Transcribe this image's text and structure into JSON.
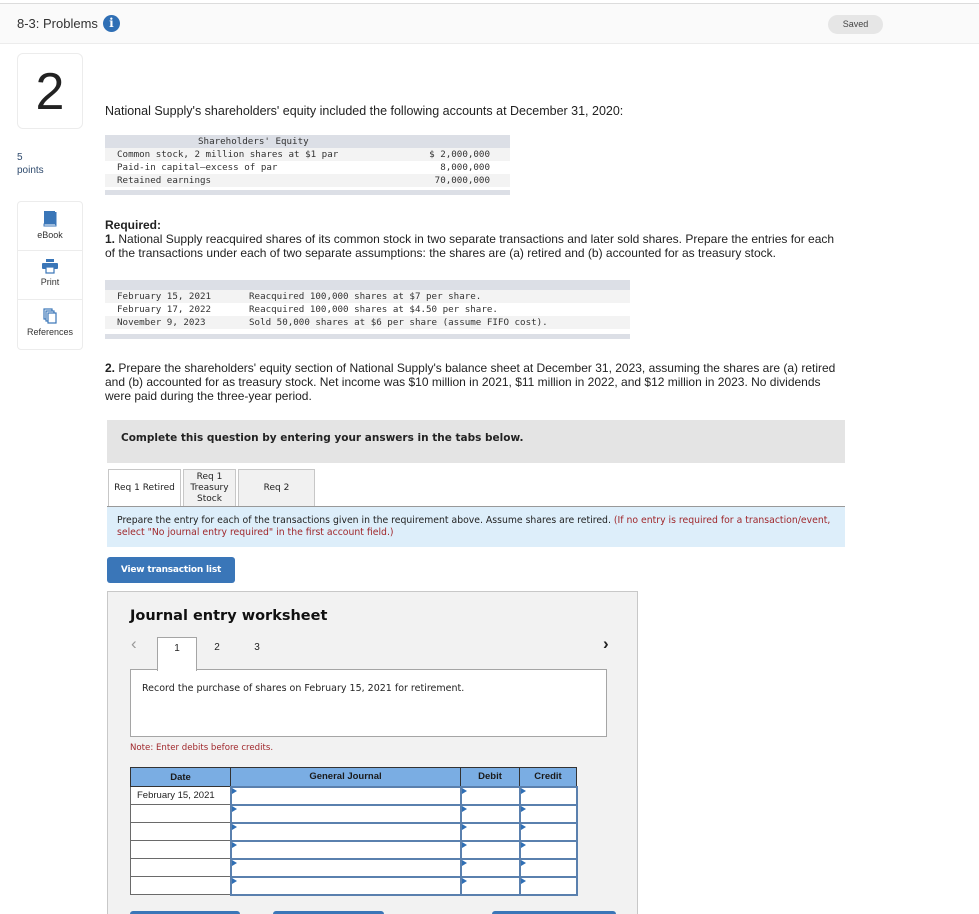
{
  "header": {
    "title": "8-3: Problems",
    "info_icon": "info-icon",
    "saved_label": "Saved"
  },
  "question": {
    "number": "2",
    "points_value": "5",
    "points_label": "points"
  },
  "tools": [
    {
      "label": "eBook",
      "icon": "book-icon"
    },
    {
      "label": "Print",
      "icon": "printer-icon"
    },
    {
      "label": "References",
      "icon": "copy-pages-icon"
    }
  ],
  "intro": "National Supply's shareholders' equity included the following accounts at December 31, 2020:",
  "equity_table": {
    "header": "Shareholders' Equity",
    "rows": [
      {
        "label": "Common stock, 2 million shares at $1 par",
        "value": "$ 2,000,000"
      },
      {
        "label": "Paid-in capital—excess of par",
        "value": "8,000,000"
      },
      {
        "label": "Retained earnings",
        "value": "70,000,000"
      }
    ]
  },
  "required": {
    "heading": "Required:",
    "req1_num": "1.",
    "req1_text": "National Supply reacquired shares of its common stock in two separate transactions and later sold shares. Prepare the entries for each of the transactions under each of two separate assumptions: the shares are (a) retired and (b) accounted for as treasury stock.",
    "req2_num": "2.",
    "req2_text": "Prepare the shareholders' equity section of National Supply's balance sheet at December 31, 2023, assuming the shares are (a) retired and (b) accounted for as treasury stock. Net income was $10 million in 2021, $11 million in 2022, and $12 million in 2023. No dividends were paid during the three-year period."
  },
  "transactions": [
    {
      "date": "February 15, 2021",
      "desc": "Reacquired 100,000 shares at $7 per share."
    },
    {
      "date": "February 17, 2022",
      "desc": "Reacquired 100,000 shares at $4.50 per share."
    },
    {
      "date": "November 9, 2023",
      "desc": "Sold 50,000 shares at $6 per share (assume FIFO cost)."
    }
  ],
  "instruction_bar": "Complete this question by entering your answers in the tabs below.",
  "tabs": [
    {
      "label": "Req 1 Retired",
      "active": true
    },
    {
      "label": "Req 1 Treasury Stock",
      "active": false
    },
    {
      "label": "Req 2",
      "active": false
    }
  ],
  "tab_note": {
    "text": "Prepare the entry for each of the transactions given in the requirement above. Assume shares are retired.",
    "hint": "(If no entry is required for a transaction/event, select \"No journal entry required\" in the first account field.)"
  },
  "view_transaction_button": "View transaction list",
  "worksheet": {
    "title": "Journal entry worksheet",
    "prev_icon": "chevron-left-icon",
    "next_icon": "chevron-right-icon",
    "pages": [
      "1",
      "2",
      "3"
    ],
    "active_page": "1",
    "prompt": "Record the purchase of shares on February 15, 2021 for retirement.",
    "note": "Note: Enter debits before credits.",
    "columns": [
      "Date",
      "General Journal",
      "Debit",
      "Credit"
    ],
    "rows": [
      {
        "date": "February 15, 2021",
        "account": "",
        "debit": "",
        "credit": ""
      },
      {
        "date": "",
        "account": "",
        "debit": "",
        "credit": ""
      },
      {
        "date": "",
        "account": "",
        "debit": "",
        "credit": ""
      },
      {
        "date": "",
        "account": "",
        "debit": "",
        "credit": ""
      },
      {
        "date": "",
        "account": "",
        "debit": "",
        "credit": ""
      },
      {
        "date": "",
        "account": "",
        "debit": "",
        "credit": ""
      }
    ]
  },
  "colors": {
    "accent_blue": "#3a76b8",
    "table_header_blue": "#7aade3",
    "note_red": "#a0282c",
    "tab_note_bg": "#ddeefa"
  }
}
